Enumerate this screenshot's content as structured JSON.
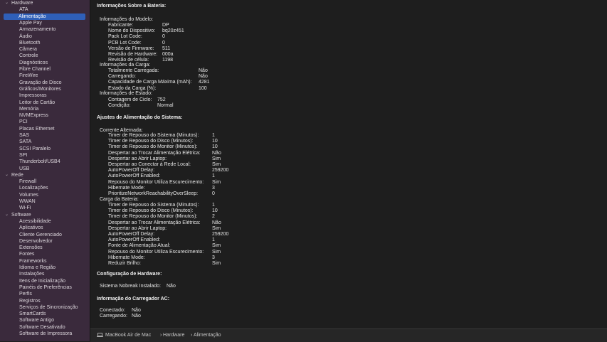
{
  "sidebar": {
    "hardware_group": "Hardware",
    "hardware_items": [
      "ATA",
      "Alimentação",
      "Apple Pay",
      "Armazenamento",
      "Áudio",
      "Bluetooth",
      "Câmera",
      "Controle",
      "Diagnósticos",
      "Fibre Channel",
      "FireWire",
      "Gravação de Disco",
      "Gráficos/Monitores",
      "Impressoras",
      "Leitor de Cartão",
      "Memória",
      "NVMExpress",
      "PCI",
      "Placas Ethernet",
      "SAS",
      "SATA",
      "SCSI Paralelo",
      "SPI",
      "Thunderbolt/USB4",
      "USB"
    ],
    "selected_item": "Alimentação",
    "network_group": "Rede",
    "network_items": [
      "Firewall",
      "Localizações",
      "Volumes",
      "WWAN",
      "Wi-Fi"
    ],
    "software_group": "Software",
    "software_items": [
      "Acessibilidade",
      "Aplicativos",
      "Cliente Gerenciado",
      "Desenvolvedor",
      "Extensões",
      "Fontes",
      "Frameworks",
      "Idioma e Região",
      "Instalações",
      "Itens de Inicialização",
      "Painéis de Preferências",
      "Perfis",
      "Registros",
      "Serviços de Sincronização",
      "SmartCards",
      "Software Antigo",
      "Software Desativado",
      "Software de Impressora"
    ]
  },
  "content": {
    "battery_title": "Informações Sobre a Bateria:",
    "model_header": "Informações do Modelo:",
    "model_rows": [
      {
        "label": "Fabricante:",
        "value": "DP"
      },
      {
        "label": "Nome do Dispositivo:",
        "value": "bq20z451"
      },
      {
        "label": "Pack Lot Code:",
        "value": "0"
      },
      {
        "label": "PCB Lot Code:",
        "value": "0"
      },
      {
        "label": "Versão de Firmware:",
        "value": "511"
      },
      {
        "label": "Revisão de Hardware:",
        "value": "000a"
      },
      {
        "label": "Revisão de célula:",
        "value": "1198"
      }
    ],
    "charge_header": "Informações da Carga:",
    "charge_rows": [
      {
        "label": "Totalmente Carregada:",
        "value": "Não"
      },
      {
        "label": "Carregando:",
        "value": "Não"
      },
      {
        "label": "Capacidade de Carga Máxima (mAh):",
        "value": "4281"
      },
      {
        "label": "Estado da Carga (%):",
        "value": "100"
      }
    ],
    "health_header": "Informações de Estado:",
    "health_rows": [
      {
        "label": "Contagem de Ciclo:",
        "value": "752"
      },
      {
        "label": "Condição:",
        "value": "Normal"
      }
    ],
    "power_title": "Ajustes de Alimentação do Sistema:",
    "ac_header": "Corrente Alternada:",
    "ac_rows": [
      {
        "label": "Timer de Repouso do Sistema (Minutos):",
        "value": "1"
      },
      {
        "label": "Timer de Repouso do Disco (Minutos):",
        "value": "10"
      },
      {
        "label": "Timer de Repouso do Monitor (Minutos):",
        "value": "10"
      },
      {
        "label": "Despertar ao Trocar Alimentação Elétrica:",
        "value": "Não"
      },
      {
        "label": "Despertar ao Abrir Laptop:",
        "value": "Sim"
      },
      {
        "label": "Despertar ao Conectar à Rede Local:",
        "value": "Sim"
      },
      {
        "label": "AutoPowerOff Delay:",
        "value": "259200"
      },
      {
        "label": "AutoPowerOff Enabled:",
        "value": "1"
      },
      {
        "label": "Repouso do Monitor Utiliza Escurecimento:",
        "value": "Sim"
      },
      {
        "label": "Hibernate Mode:",
        "value": "3"
      },
      {
        "label": "PrioritizeNetworkReachabilityOverSleep:",
        "value": "0"
      }
    ],
    "battery_power_header": "Carga da Bateria:",
    "battery_power_rows": [
      {
        "label": "Timer de Repouso do Sistema (Minutos):",
        "value": "1"
      },
      {
        "label": "Timer de Repouso do Disco (Minutos):",
        "value": "10"
      },
      {
        "label": "Timer de Repouso do Monitor (Minutos):",
        "value": "2"
      },
      {
        "label": "Despertar ao Trocar Alimentação Elétrica:",
        "value": "Não"
      },
      {
        "label": "Despertar ao Abrir Laptop:",
        "value": "Sim"
      },
      {
        "label": "AutoPowerOff Delay:",
        "value": "259200"
      },
      {
        "label": "AutoPowerOff Enabled:",
        "value": "1"
      },
      {
        "label": "Fonte de Alimentação Atual:",
        "value": "Sim"
      },
      {
        "label": "Repouso do Monitor Utiliza Escurecimento:",
        "value": "Sim"
      },
      {
        "label": "Hibernate Mode:",
        "value": "3"
      },
      {
        "label": "Reduzir Brilho:",
        "value": "Sim"
      }
    ],
    "hardware_config_title": "Configuração de Hardware:",
    "ups_label": "Sistema Nobreak Instalado:",
    "ups_value": "Não",
    "ac_charger_title": "Informação do Carregador AC:",
    "charger_rows": [
      {
        "label": "Conectado:",
        "value": "Não"
      },
      {
        "label": "Carregando:",
        "value": "Não"
      }
    ]
  },
  "statusbar": {
    "icon": "laptop-icon",
    "crumbs": [
      "MacBook Air de Mac",
      "Hardware",
      "Alimentação"
    ],
    "separator": "›"
  },
  "colors": {
    "sidebar_bg": "#3a2a3c",
    "selection": "#2f5fb8",
    "main_bg": "#1e1e1e"
  }
}
